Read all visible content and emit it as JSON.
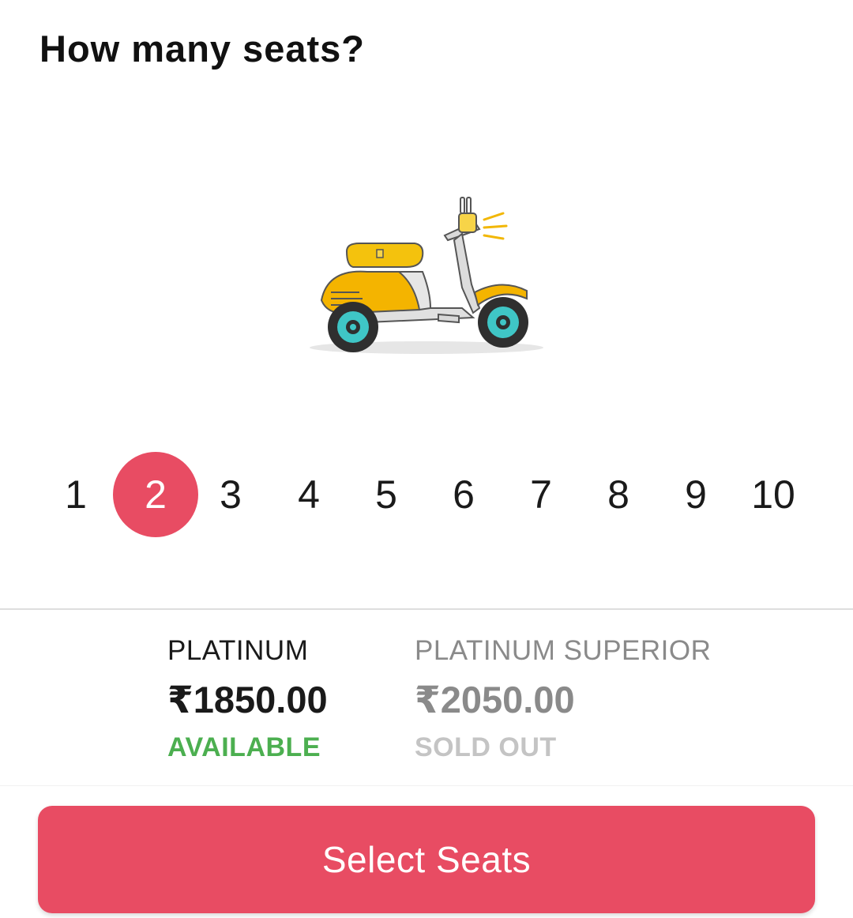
{
  "header": {
    "title": "How many seats?"
  },
  "illustration": {
    "icon": "scooter-icon"
  },
  "seats": {
    "options": [
      "1",
      "2",
      "3",
      "4",
      "5",
      "6",
      "7",
      "8",
      "9",
      "10"
    ],
    "selected": "2"
  },
  "categories": [
    {
      "name": "PLATINUM",
      "price": "₹1850.00",
      "status": "AVAILABLE"
    },
    {
      "name": "PLATINUM SUPERIOR",
      "price": "₹2050.00",
      "status": "SOLD OUT"
    }
  ],
  "footer": {
    "button_label": "Select Seats"
  },
  "colors": {
    "accent": "#e84c63",
    "available": "#4caf50",
    "sold_out": "#c4c4c4",
    "muted_text": "#8a8a8a"
  }
}
